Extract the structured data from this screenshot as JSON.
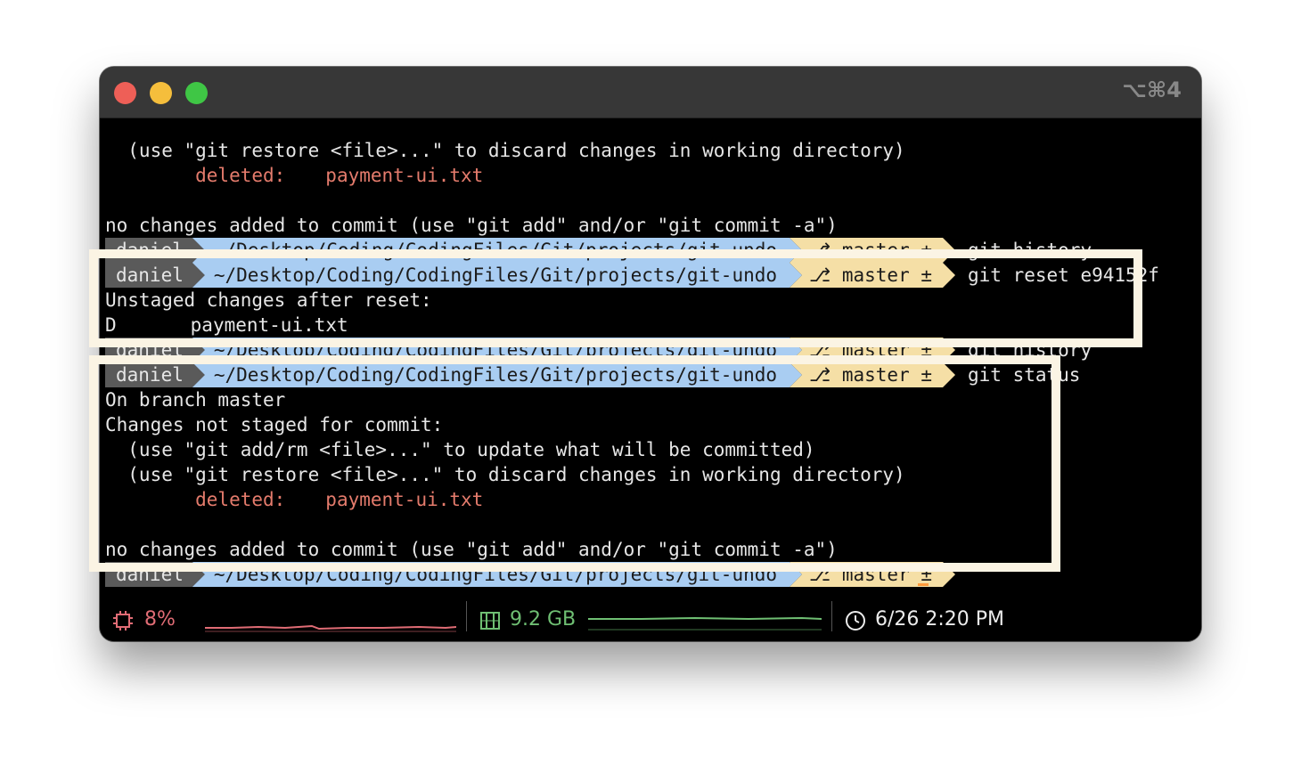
{
  "window": {
    "shortcut": "⌥⌘4"
  },
  "terminal": {
    "lines": {
      "l1": "  (use \"git restore <file>...\" to discard changes in working directory)",
      "l2_label": "        deleted:",
      "l2_file": "payment-ui.txt",
      "l4": "no changes added to commit (use \"git add\" and/or \"git commit -a\")",
      "l7": "Unstaged changes after reset:",
      "l8_flag": "D",
      "l8_file": "payment-ui.txt",
      "l10": "On branch master",
      "l11": "Changes not staged for commit:",
      "l12": "  (use \"git add/rm <file>...\" to update what will be committed)",
      "l13": "  (use \"git restore <file>...\" to discard changes in working directory)",
      "l14_label": "        deleted:",
      "l14_file": "payment-ui.txt",
      "l16": "no changes added to commit (use \"git add\" and/or \"git commit -a\")"
    },
    "prompt": {
      "user": "daniel",
      "path": "~/Desktop/Coding/CodingFiles/Git/projects/git-undo",
      "branch": "master ±"
    },
    "commands": {
      "history": "git history",
      "reset": "git reset e94152f",
      "status": "git status"
    }
  },
  "statusbar": {
    "cpu": "8%",
    "memory": "9.2 GB",
    "time": "6/26 2:20 PM",
    "colors": {
      "cpu": "#e06c75",
      "memory": "#6fbf73"
    }
  },
  "icons": {
    "cpu": "cpu-chip-icon",
    "memory": "memory-icon",
    "clock": "clock-icon",
    "branch": "git-branch-icon"
  }
}
